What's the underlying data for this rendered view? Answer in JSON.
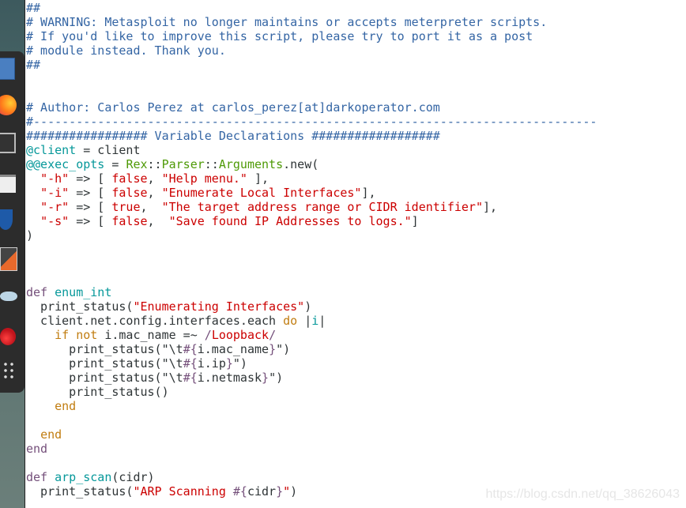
{
  "dock": {
    "items": [
      {
        "name": "file-manager-icon",
        "color": "#4a7fc1"
      },
      {
        "name": "firefox-icon",
        "color": "#ff7a1a"
      },
      {
        "name": "terminal-icon",
        "color": "#333333"
      },
      {
        "name": "text-editor-icon",
        "color": "#eeeeee"
      },
      {
        "name": "metasploit-icon",
        "color": "#1e5aa8"
      },
      {
        "name": "burpsuite-icon",
        "color": "#e8692c"
      },
      {
        "name": "maltego-eye-icon",
        "color": "#bcd6e6"
      },
      {
        "name": "cherrytree-icon",
        "color": "#c0141c"
      },
      {
        "name": "app-grid-icon",
        "color": "#dddddd"
      }
    ]
  },
  "code": {
    "lines": [
      [
        [
          "c",
          "##"
        ]
      ],
      [
        [
          "c",
          "# WARNING: Metasploit no longer maintains or accepts meterpreter scripts."
        ]
      ],
      [
        [
          "c",
          "# If you'd like to improve this script, please try to port it as a post"
        ]
      ],
      [
        [
          "c",
          "# module instead. Thank you."
        ]
      ],
      [
        [
          "c",
          "##"
        ]
      ],
      [],
      [],
      [
        [
          "c",
          "# Author: Carlos Perez at carlos_perez[at]darkoperator.com"
        ]
      ],
      [
        [
          "c",
          "#-------------------------------------------------------------------------------"
        ]
      ],
      [
        [
          "c",
          "################# Variable Declarations ##################"
        ]
      ],
      [
        [
          "f",
          "@client"
        ],
        [
          "p",
          " = client"
        ]
      ],
      [
        [
          "f",
          "@@exec_opts"
        ],
        [
          "p",
          " = "
        ],
        [
          "g",
          "Rex"
        ],
        [
          "p",
          "::"
        ],
        [
          "g",
          "Parser"
        ],
        [
          "p",
          "::"
        ],
        [
          "g",
          "Arguments"
        ],
        [
          "p",
          ".new("
        ]
      ],
      [
        [
          "p",
          "  "
        ],
        [
          "s",
          "\"-h\""
        ],
        [
          "p",
          " => [ "
        ],
        [
          "s",
          "false"
        ],
        [
          "p",
          ", "
        ],
        [
          "s",
          "\"Help menu.\""
        ],
        [
          "p",
          " ],"
        ]
      ],
      [
        [
          "p",
          "  "
        ],
        [
          "s",
          "\"-i\""
        ],
        [
          "p",
          " => [ "
        ],
        [
          "s",
          "false"
        ],
        [
          "p",
          ", "
        ],
        [
          "s",
          "\"Enumerate Local Interfaces\""
        ],
        [
          "p",
          "],"
        ]
      ],
      [
        [
          "p",
          "  "
        ],
        [
          "s",
          "\"-r\""
        ],
        [
          "p",
          " => [ "
        ],
        [
          "s",
          "true"
        ],
        [
          "p",
          ",  "
        ],
        [
          "s",
          "\"The target address range or CIDR identifier\""
        ],
        [
          "p",
          "],"
        ]
      ],
      [
        [
          "p",
          "  "
        ],
        [
          "s",
          "\"-s\""
        ],
        [
          "p",
          " => [ "
        ],
        [
          "s",
          "false"
        ],
        [
          "p",
          ",  "
        ],
        [
          "s",
          "\"Save found IP Addresses to logs.\""
        ],
        [
          "p",
          "]"
        ]
      ],
      [
        [
          "p",
          ")"
        ]
      ],
      [],
      [],
      [],
      [
        [
          "k",
          "def"
        ],
        [
          "p",
          " "
        ],
        [
          "f",
          "enum_int"
        ]
      ],
      [
        [
          "p",
          "  print_status("
        ],
        [
          "s",
          "\"Enumerating Interfaces\""
        ],
        [
          "p",
          ")"
        ]
      ],
      [
        [
          "p",
          "  client.net.config.interfaces.each "
        ],
        [
          "o",
          "do"
        ],
        [
          "p",
          " |"
        ],
        [
          "f",
          "i"
        ],
        [
          "p",
          "|"
        ]
      ],
      [
        [
          "p",
          "    "
        ],
        [
          "o",
          "if not"
        ],
        [
          "p",
          " i.mac_name =~ "
        ],
        [
          "k",
          "/"
        ],
        [
          "s",
          "Loopback"
        ],
        [
          "k",
          "/"
        ]
      ],
      [
        [
          "p",
          "      print_status(\"\\t"
        ],
        [
          "i",
          "#{"
        ],
        [
          "p",
          "i.mac_name"
        ],
        [
          "i",
          "}"
        ],
        [
          "p",
          "\")"
        ]
      ],
      [
        [
          "p",
          "      print_status(\"\\t"
        ],
        [
          "i",
          "#{"
        ],
        [
          "p",
          "i.ip"
        ],
        [
          "i",
          "}"
        ],
        [
          "p",
          "\")"
        ]
      ],
      [
        [
          "p",
          "      print_status(\"\\t"
        ],
        [
          "i",
          "#{"
        ],
        [
          "p",
          "i.netmask"
        ],
        [
          "i",
          "}"
        ],
        [
          "p",
          "\")"
        ]
      ],
      [
        [
          "p",
          "      print_status()"
        ]
      ],
      [
        [
          "p",
          "    "
        ],
        [
          "o",
          "end"
        ]
      ],
      [],
      [
        [
          "p",
          "  "
        ],
        [
          "o",
          "end"
        ]
      ],
      [
        [
          "k",
          "end"
        ]
      ],
      [],
      [
        [
          "k",
          "def"
        ],
        [
          "p",
          " "
        ],
        [
          "f",
          "arp_scan"
        ],
        [
          "p",
          "(cidr)"
        ]
      ],
      [
        [
          "p",
          "  print_status("
        ],
        [
          "s",
          "\"ARP Scanning "
        ],
        [
          "i",
          "#{"
        ],
        [
          "p",
          "cidr"
        ],
        [
          "i",
          "}"
        ],
        [
          "s",
          "\""
        ],
        [
          "p",
          ")"
        ]
      ]
    ]
  },
  "watermark": "https://blog.csdn.net/qq_38626043"
}
